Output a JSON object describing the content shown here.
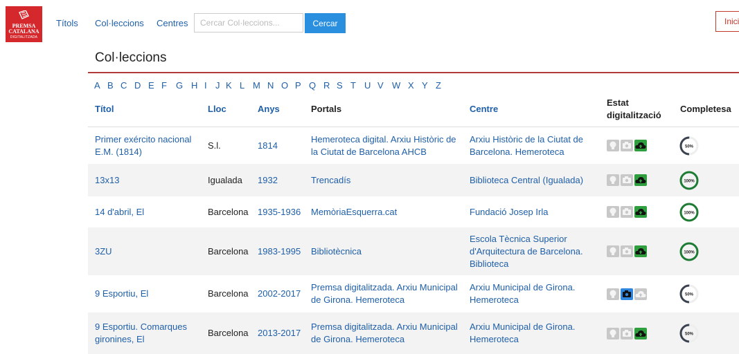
{
  "brand": {
    "line1": "PREMSA",
    "line2": "CATALANA",
    "line3": "DIGITALITZADA"
  },
  "nav": {
    "titols": "Títols",
    "colleccions": "Col·leccions",
    "centres": "Centres"
  },
  "search": {
    "placeholder": "Cercar Col·leccions...",
    "button": "Cercar"
  },
  "login": {
    "label": "Inici"
  },
  "page": {
    "title": "Col·leccions"
  },
  "alphabet": [
    "A",
    "B",
    "C",
    "D",
    "E",
    "F",
    "G",
    "H",
    "I",
    "J",
    "K",
    "L",
    "M",
    "N",
    "O",
    "P",
    "Q",
    "R",
    "S",
    "T",
    "U",
    "V",
    "W",
    "X",
    "Y",
    "Z"
  ],
  "table": {
    "headers": {
      "titol": "Títol",
      "lloc": "Lloc",
      "anys": "Anys",
      "portals": "Portals",
      "centre": "Centre",
      "estat_1": "Estat",
      "estat_2": "digitalització",
      "completesa": "Completesa"
    },
    "rows": [
      {
        "titol": [
          "Primer exército nacional",
          "E.M. (1814)"
        ],
        "lloc": "S.l.",
        "anys": "1814",
        "portal": [
          "Hemeroteca digital. Arxiu Històric de",
          "la Ciutat de Barcelona AHCB"
        ],
        "centre": [
          "Arxiu Històric de la Ciutat de",
          "Barcelona. Hemeroteca"
        ],
        "status_active": "cloud",
        "completesa": "50%",
        "completesa_value": 50
      },
      {
        "titol": [
          "13x13"
        ],
        "lloc": "Igualada",
        "anys": "1932",
        "portal": [
          "Trencadís"
        ],
        "centre": [
          "Biblioteca Central (Igualada)"
        ],
        "status_active": "cloud",
        "completesa": "100%",
        "completesa_value": 100
      },
      {
        "titol": [
          "14 d'abril, El"
        ],
        "lloc": "Barcelona",
        "anys": "1935-1936",
        "portal": [
          "MemòriaEsquerra.cat"
        ],
        "centre": [
          "Fundació Josep Irla"
        ],
        "status_active": "cloud",
        "completesa": "100%",
        "completesa_value": 100
      },
      {
        "titol": [
          "3ZU"
        ],
        "lloc": "Barcelona",
        "anys": "1983-1995",
        "portal": [
          "Bibliotècnica"
        ],
        "centre": [
          "Escola Tècnica Superior",
          "d'Arquitectura de Barcelona.",
          "Biblioteca"
        ],
        "status_active": "cloud",
        "completesa": "100%",
        "completesa_value": 100
      },
      {
        "titol": [
          "9 Esportiu, El"
        ],
        "lloc": "Barcelona",
        "anys": "2002-2017",
        "portal": [
          "Premsa digitalitzada. Arxiu Municipal",
          "de Girona. Hemeroteca"
        ],
        "centre": [
          "Arxiu Municipal de Girona.",
          "Hemeroteca"
        ],
        "status_active": "camera",
        "completesa": "50%",
        "completesa_value": 50
      },
      {
        "titol": [
          "9 Esportiu. Comarques",
          "gironines, El"
        ],
        "lloc": "Barcelona",
        "anys": "2013-2017",
        "portal": [
          "Premsa digitalitzada. Arxiu Municipal",
          "de Girona. Hemeroteca"
        ],
        "centre": [
          "Arxiu Municipal de Girona.",
          "Hemeroteca"
        ],
        "status_active": "cloud",
        "completesa": "50%",
        "completesa_value": 50
      }
    ]
  },
  "colors": {
    "brand_red": "#d5282d",
    "link": "#1f5fa8",
    "button_blue": "#2b8fe0",
    "ring_green": "#1e7b34",
    "ring_dark": "#3b4250",
    "status_grey": "#c8c8c8",
    "status_green": "#2e9e3f",
    "status_blue": "#2e86de"
  }
}
